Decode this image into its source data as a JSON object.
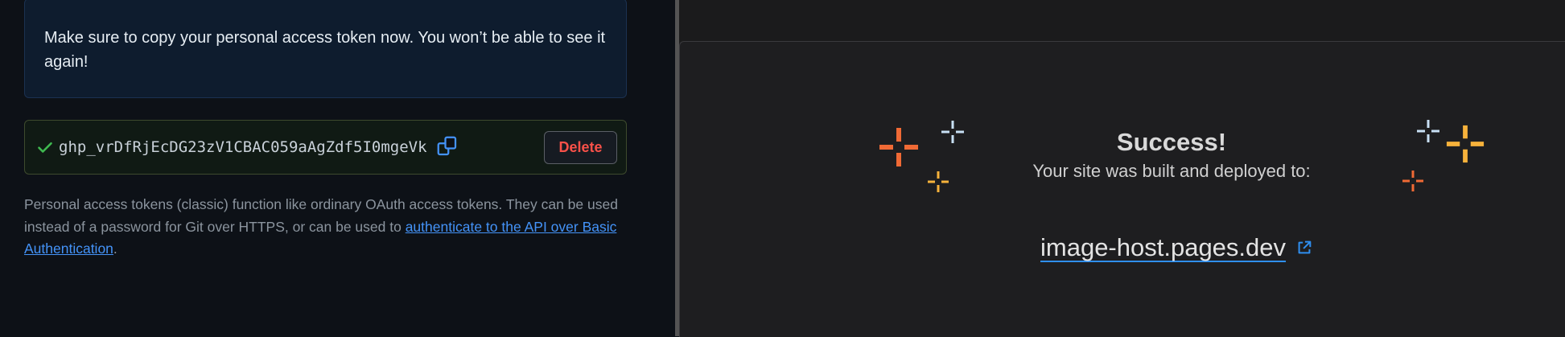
{
  "left_pane": {
    "notice_text": "Make sure to copy your personal access token now. You won’t be able to see it again!",
    "token": {
      "value": "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",
      "check_icon": "check-icon",
      "copy_icon": "copy-icon",
      "delete_label": "Delete"
    },
    "description": {
      "text_before": "Personal access tokens (classic) function like ordinary OAuth access tokens. They can be used instead of a password for Git over HTTPS, or can be used to ",
      "link_text": "authenticate to the API over Basic Authentication",
      "text_after": "."
    }
  },
  "right_pane": {
    "title": "Success!",
    "subtitle": "Your site was built and deployed to:",
    "site_url_text": "image-host.pages.dev",
    "external_link_icon": "external-link-icon"
  },
  "colors": {
    "accent_blue": "#4493f8",
    "danger_red": "#f85149",
    "success_green": "#3fb950",
    "sparkle_orange": "#f06a35",
    "sparkle_amber": "#f7b23b",
    "sparkle_light_blue": "#c8e0f4"
  }
}
